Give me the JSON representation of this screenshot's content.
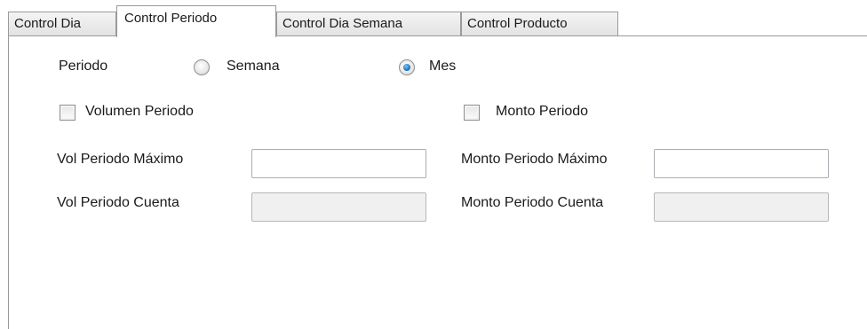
{
  "tabs": [
    {
      "label": "Control Dia"
    },
    {
      "label": "Control Periodo",
      "selected": true
    },
    {
      "label": "Control Dia Semana"
    },
    {
      "label": "Control Producto"
    }
  ],
  "periodo": {
    "label": "Periodo",
    "options": [
      {
        "label": "Semana",
        "selected": false
      },
      {
        "label": "Mes",
        "selected": true
      }
    ]
  },
  "checkboxes": {
    "volumen": {
      "label": "Volumen Periodo",
      "checked": false
    },
    "monto": {
      "label": "Monto Periodo",
      "checked": false
    }
  },
  "fields": {
    "vol_maximo": {
      "label": "Vol Periodo Máximo",
      "value": ""
    },
    "vol_cuenta": {
      "label": "Vol Periodo Cuenta",
      "value": "",
      "readonly": true
    },
    "monto_maximo": {
      "label": "Monto Periodo Máximo",
      "value": ""
    },
    "monto_cuenta": {
      "label": "Monto Periodo Cuenta",
      "value": "",
      "readonly": true
    }
  }
}
